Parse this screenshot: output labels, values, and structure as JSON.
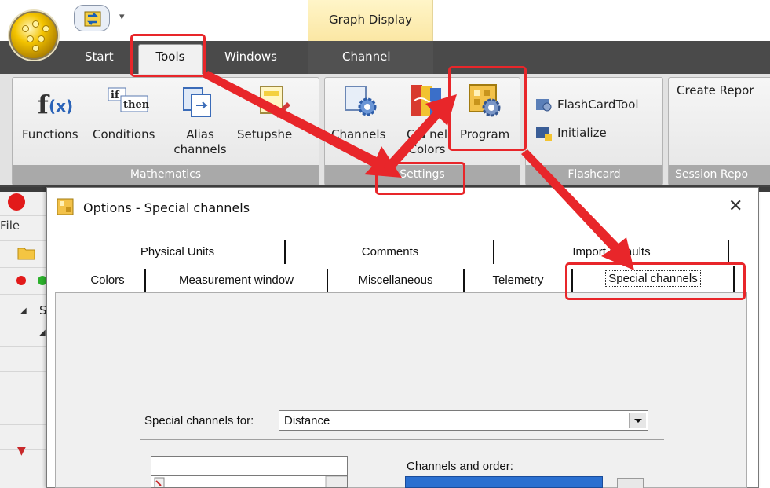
{
  "ribbon": {
    "contextual_tab": "Graph Display",
    "quick_access_more": "▾",
    "tabs": [
      "Start",
      "Tools",
      "Windows",
      "Channel"
    ],
    "groups": {
      "mathematics": {
        "label": "Mathematics",
        "buttons": [
          {
            "label_line1": "Functions",
            "label_line2": ""
          },
          {
            "label_line1": "Conditions",
            "label_line2": ""
          },
          {
            "label_line1": "Alias",
            "label_line2": "channels"
          },
          {
            "label_line1": "Setupshe",
            "label_line2": ""
          }
        ]
      },
      "settings": {
        "label": "Settings",
        "buttons": [
          {
            "label_line1": "Channels",
            "label_line2": ""
          },
          {
            "label_line1": "C  a  nel",
            "label_line2": "Colors"
          },
          {
            "label_line1": "Program",
            "label_line2": ""
          }
        ]
      },
      "flashcard": {
        "label": "Flashcard",
        "buttons": [
          "FlashCardTool",
          "Initialize"
        ]
      },
      "session_report": {
        "label": "Session Repo",
        "button": "Create Repor"
      }
    }
  },
  "background_app": {
    "menu_file": "File",
    "tree_label": "S"
  },
  "dialog": {
    "title": "Options - Special channels",
    "close": "✕",
    "tabs_row1": [
      "Physical Units",
      "Comments",
      "Import defaults"
    ],
    "tabs_row2": [
      "Colors",
      "Measurement window",
      "Miscellaneous",
      "Telemetry",
      "Special channels"
    ],
    "active_tab": "Special channels",
    "special_channels_for_label": "Special channels for:",
    "special_channels_for_value": "Distance",
    "search_value": "",
    "channels_and_order_label": "Channels and order:"
  },
  "colors": {
    "highlight": "#e8262a",
    "ribbon_tab_strip": "#4a4a4a",
    "group_label_bg": "#a9a9a9",
    "contextual_tab_bg": "#fbe7a4",
    "selection_blue": "#2a6fd0"
  }
}
